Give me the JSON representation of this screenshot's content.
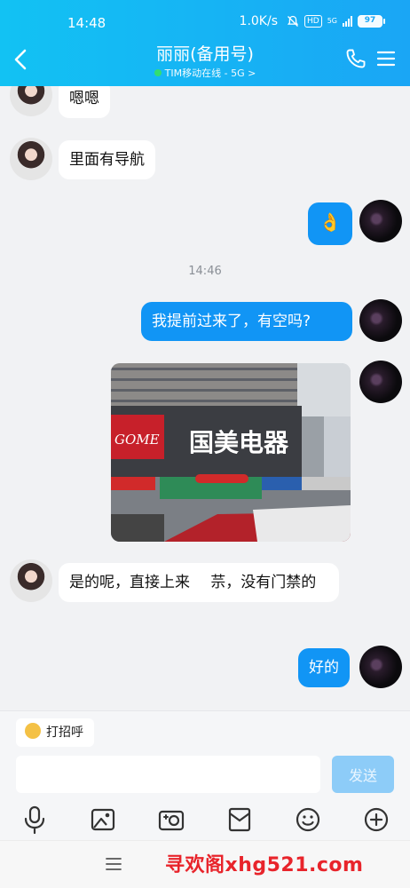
{
  "status_bar": {
    "time": "14:48",
    "speed": "1.0K/s",
    "hd": "HD",
    "net": "5G",
    "battery": "97"
  },
  "header": {
    "title": "丽丽(备用号)",
    "subtitle": "TIM移动在线 - 5G >",
    "accent": "#12c2f3"
  },
  "messages": [
    {
      "sender": "other",
      "text": "嗯嗯"
    },
    {
      "sender": "other",
      "text": "里面有导航"
    },
    {
      "sender": "me",
      "text": "👌"
    },
    {
      "timestamp": "14:46"
    },
    {
      "sender": "me",
      "text": "我提前过来了，有空吗?"
    },
    {
      "sender": "me",
      "type": "image"
    },
    {
      "sender": "other",
      "text": "是的呢，直接上来 ⠀ 䒬，没有门禁的"
    },
    {
      "sender": "me",
      "text": "好的"
    }
  ],
  "photo": {
    "sign_main": "国美电器",
    "sign_left": "GOME"
  },
  "input": {
    "greet_label": "打招呼",
    "placeholder": "",
    "send_label": "发送"
  },
  "toolbar": {
    "icons": [
      "microphone-icon",
      "image-icon",
      "camera-icon",
      "red-packet-icon",
      "emoji-icon",
      "plus-icon"
    ]
  },
  "watermark": "寻欢阁xhg521.com"
}
